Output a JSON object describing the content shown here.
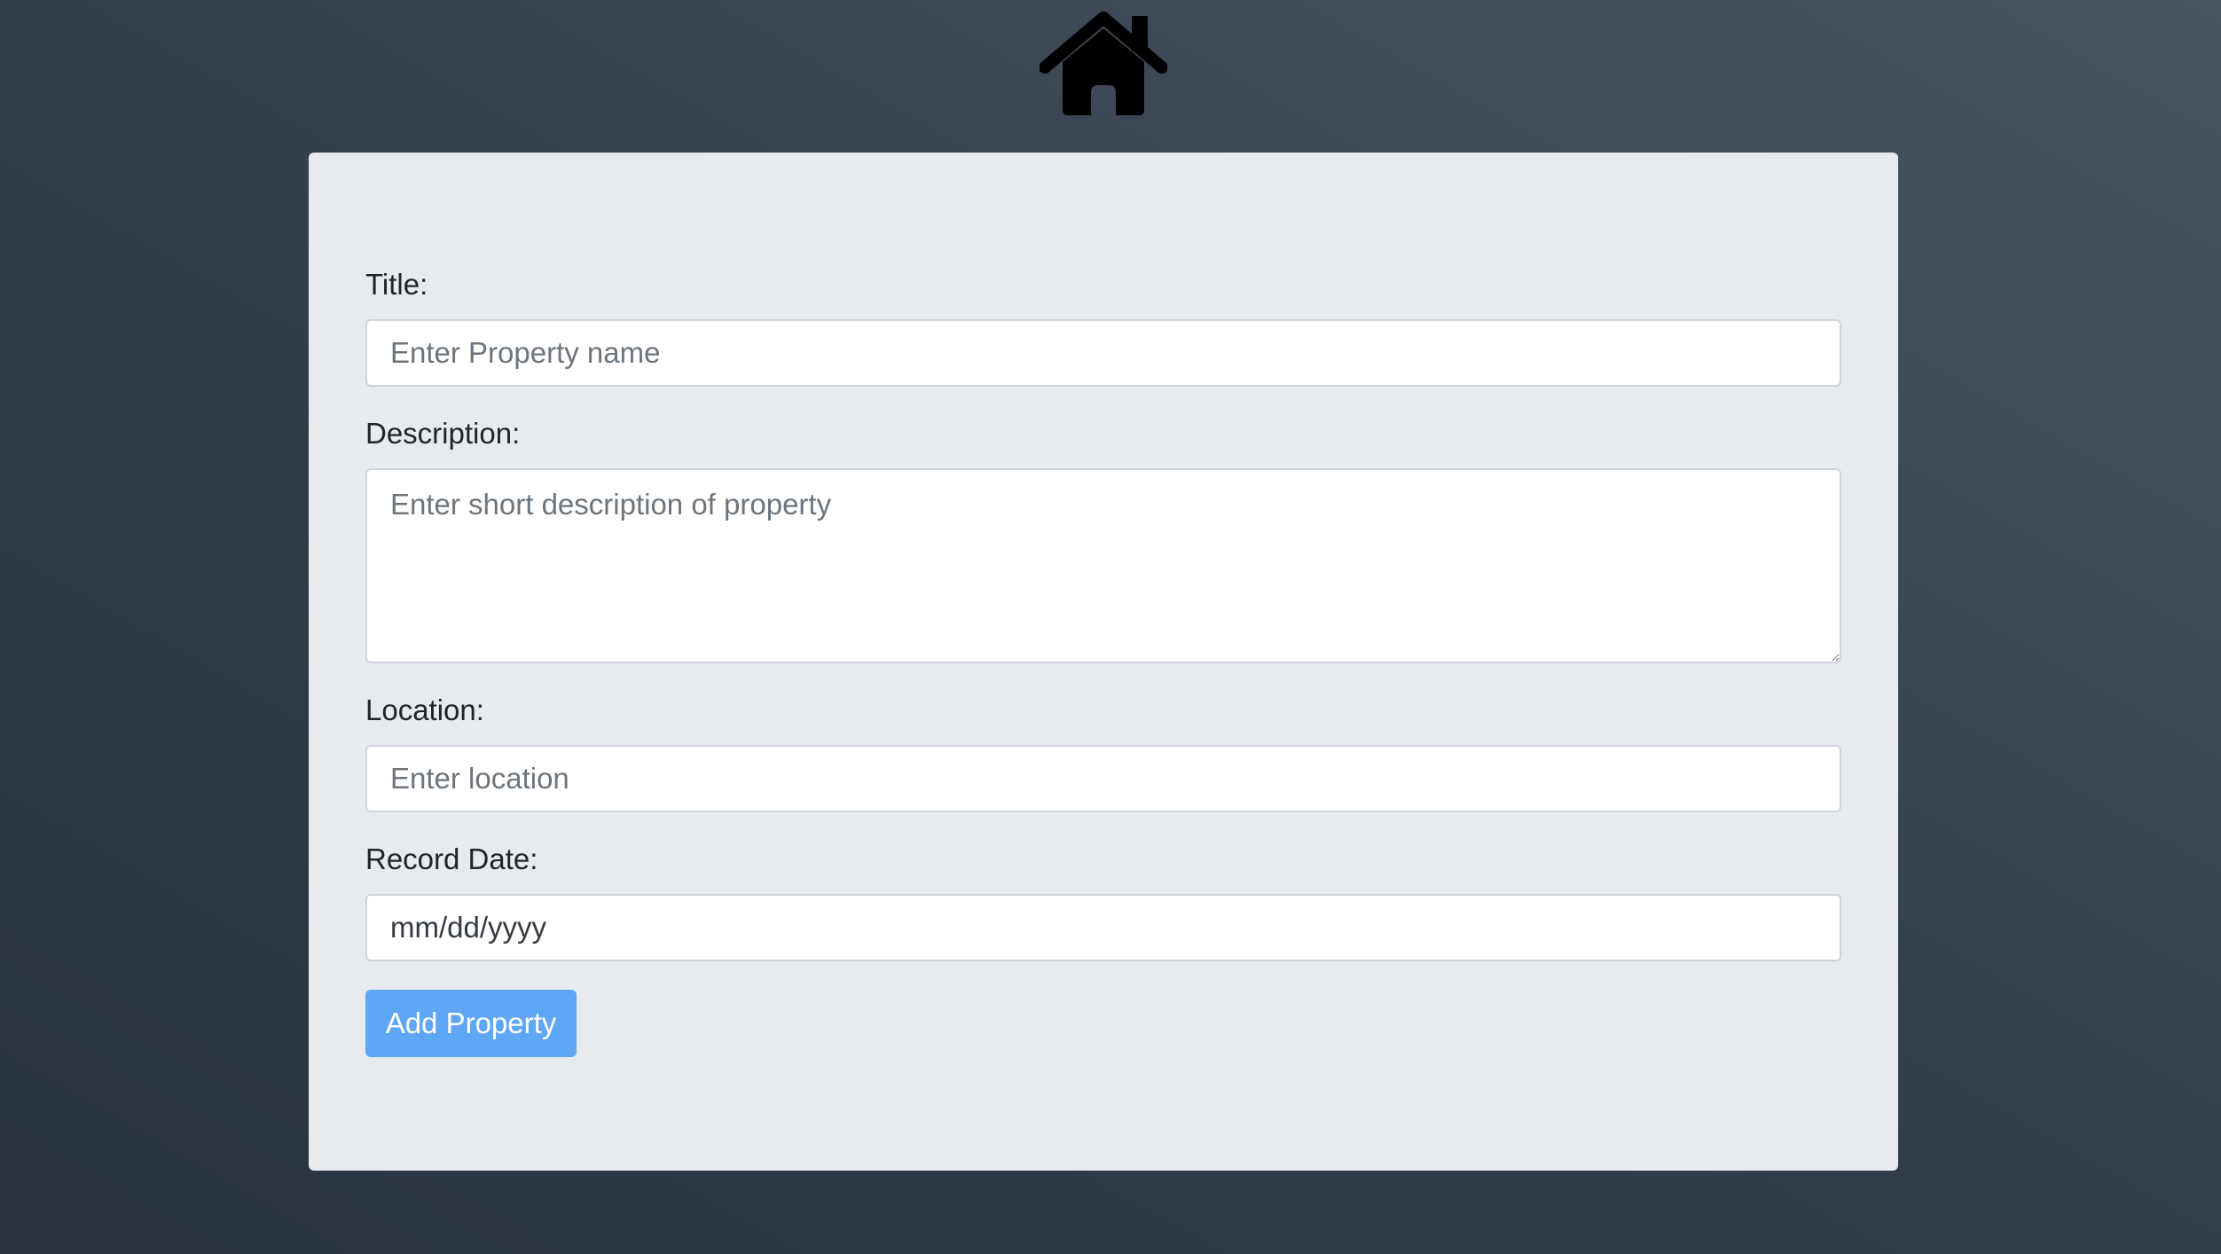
{
  "header": {
    "logo_icon": "home-icon"
  },
  "form": {
    "title": {
      "label": "Title:",
      "placeholder": "Enter Property name"
    },
    "description": {
      "label": "Description:",
      "placeholder": "Enter short description of property"
    },
    "location": {
      "label": "Location:",
      "placeholder": "Enter location"
    },
    "record_date": {
      "label": "Record Date:",
      "value": "mm/dd/yyyy"
    },
    "submit_label": "Add Property"
  },
  "colors": {
    "background": "#323c4a",
    "card": "#e7ebee",
    "button": "#5fa7f5",
    "button_text": "#ffffff"
  }
}
